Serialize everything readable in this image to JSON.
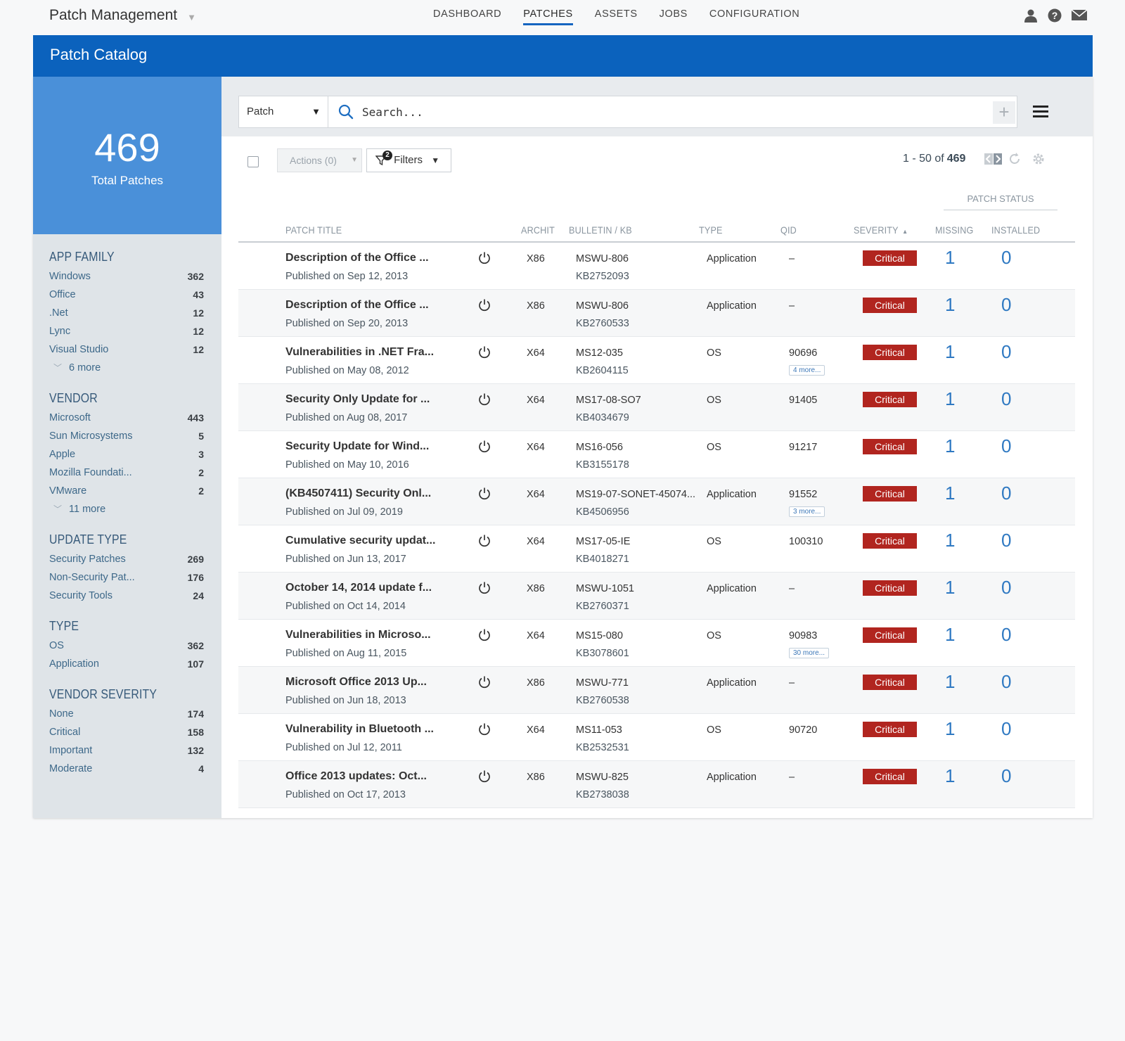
{
  "app": {
    "title": "Patch Management",
    "nav": [
      "DASHBOARD",
      "PATCHES",
      "ASSETS",
      "JOBS",
      "CONFIGURATION"
    ],
    "active_nav": "PATCHES",
    "icons": [
      "user-icon",
      "help-icon",
      "mail-icon"
    ]
  },
  "page": {
    "title": "Patch Catalog"
  },
  "summary": {
    "total": "469",
    "label": "Total Patches"
  },
  "facets": [
    {
      "title": "APP FAMILY",
      "items": [
        {
          "name": "Windows",
          "count": "362"
        },
        {
          "name": "Office",
          "count": "43"
        },
        {
          "name": ".Net",
          "count": "12"
        },
        {
          "name": "Lync",
          "count": "12"
        },
        {
          "name": "Visual Studio",
          "count": "12"
        }
      ],
      "more": "6 more"
    },
    {
      "title": "VENDOR",
      "items": [
        {
          "name": "Microsoft",
          "count": "443"
        },
        {
          "name": "Sun Microsystems",
          "count": "5"
        },
        {
          "name": "Apple",
          "count": "3"
        },
        {
          "name": "Mozilla Foundati...",
          "count": "2"
        },
        {
          "name": "VMware",
          "count": "2"
        }
      ],
      "more": "11 more"
    },
    {
      "title": "UPDATE TYPE",
      "items": [
        {
          "name": "Security Patches",
          "count": "269"
        },
        {
          "name": "Non-Security Pat...",
          "count": "176"
        },
        {
          "name": "Security Tools",
          "count": "24"
        }
      ]
    },
    {
      "title": "TYPE",
      "items": [
        {
          "name": "OS",
          "count": "362"
        },
        {
          "name": "Application",
          "count": "107"
        }
      ]
    },
    {
      "title": "VENDOR SEVERITY",
      "items": [
        {
          "name": "None",
          "count": "174"
        },
        {
          "name": "Critical",
          "count": "158"
        },
        {
          "name": "Important",
          "count": "132"
        },
        {
          "name": "Moderate",
          "count": "4"
        }
      ]
    }
  ],
  "search": {
    "scope": "Patch",
    "placeholder": "Search...",
    "add_label": "+"
  },
  "toolbar": {
    "actions_label": "Actions (0)",
    "filters_label": "Filters",
    "filters_badge": "2",
    "pager_range": "1 - 50 of",
    "pager_total": "469"
  },
  "table": {
    "group_header": "PATCH STATUS",
    "headers": {
      "title": "PATCH TITLE",
      "arch": "ARCHIT",
      "bulletin": "BULLETIN / KB",
      "type": "TYPE",
      "qid": "QID",
      "severity": "SEVERITY",
      "missing": "MISSING",
      "installed": "INSTALLED"
    },
    "rows": [
      {
        "title": "Description of the Office ...",
        "published": "Published on Sep 12, 2013",
        "arch": "X86",
        "bulletin": "MSWU-806",
        "kb": "KB2752093",
        "type": "Application",
        "qid": "–",
        "qid_more": "",
        "severity": "Critical",
        "missing": "1",
        "installed": "0"
      },
      {
        "title": "Description of the Office ...",
        "published": "Published on Sep 20, 2013",
        "arch": "X86",
        "bulletin": "MSWU-806",
        "kb": "KB2760533",
        "type": "Application",
        "qid": "–",
        "qid_more": "",
        "severity": "Critical",
        "missing": "1",
        "installed": "0"
      },
      {
        "title": "Vulnerabilities in .NET Fra...",
        "published": "Published on May 08, 2012",
        "arch": "X64",
        "bulletin": "MS12-035",
        "kb": "KB2604115",
        "type": "OS",
        "qid": "90696",
        "qid_more": "4 more...",
        "severity": "Critical",
        "missing": "1",
        "installed": "0"
      },
      {
        "title": "Security Only Update for ...",
        "published": "Published on Aug 08, 2017",
        "arch": "X64",
        "bulletin": "MS17-08-SO7",
        "kb": "KB4034679",
        "type": "OS",
        "qid": "91405",
        "qid_more": "",
        "severity": "Critical",
        "missing": "1",
        "installed": "0"
      },
      {
        "title": "Security Update for Wind...",
        "published": "Published on May 10, 2016",
        "arch": "X64",
        "bulletin": "MS16-056",
        "kb": "KB3155178",
        "type": "OS",
        "qid": "91217",
        "qid_more": "",
        "severity": "Critical",
        "missing": "1",
        "installed": "0"
      },
      {
        "title": "(KB4507411) Security Onl...",
        "published": "Published on Jul 09, 2019",
        "arch": "X64",
        "bulletin": "MS19-07-SONET-45074...",
        "kb": "KB4506956",
        "type": "Application",
        "qid": "91552",
        "qid_more": "3 more...",
        "severity": "Critical",
        "missing": "1",
        "installed": "0"
      },
      {
        "title": "Cumulative security updat...",
        "published": "Published on Jun 13, 2017",
        "arch": "X64",
        "bulletin": "MS17-05-IE",
        "kb": "KB4018271",
        "type": "OS",
        "qid": "100310",
        "qid_more": "",
        "severity": "Critical",
        "missing": "1",
        "installed": "0"
      },
      {
        "title": "October 14, 2014 update f...",
        "published": "Published on Oct 14, 2014",
        "arch": "X86",
        "bulletin": "MSWU-1051",
        "kb": "KB2760371",
        "type": "Application",
        "qid": "–",
        "qid_more": "",
        "severity": "Critical",
        "missing": "1",
        "installed": "0"
      },
      {
        "title": "Vulnerabilities in Microso...",
        "published": "Published on Aug 11, 2015",
        "arch": "X64",
        "bulletin": "MS15-080",
        "kb": "KB3078601",
        "type": "OS",
        "qid": "90983",
        "qid_more": "30 more...",
        "severity": "Critical",
        "missing": "1",
        "installed": "0"
      },
      {
        "title": "Microsoft Office 2013 Up...",
        "published": "Published on Jun 18, 2013",
        "arch": "X86",
        "bulletin": "MSWU-771",
        "kb": "KB2760538",
        "type": "Application",
        "qid": "–",
        "qid_more": "",
        "severity": "Critical",
        "missing": "1",
        "installed": "0"
      },
      {
        "title": "Vulnerability in Bluetooth ...",
        "published": "Published on Jul 12, 2011",
        "arch": "X64",
        "bulletin": "MS11-053",
        "kb": "KB2532531",
        "type": "OS",
        "qid": "90720",
        "qid_more": "",
        "severity": "Critical",
        "missing": "1",
        "installed": "0"
      },
      {
        "title": "Office 2013 updates: Oct...",
        "published": "Published on Oct 17, 2013",
        "arch": "X86",
        "bulletin": "MSWU-825",
        "kb": "KB2738038",
        "type": "Application",
        "qid": "–",
        "qid_more": "",
        "severity": "Critical",
        "missing": "1",
        "installed": "0"
      }
    ]
  },
  "colors": {
    "brand_blue": "#0b62bd",
    "summary_blue": "#4a90d9",
    "critical_red": "#b1251f",
    "link_blue": "#2f79c2"
  }
}
